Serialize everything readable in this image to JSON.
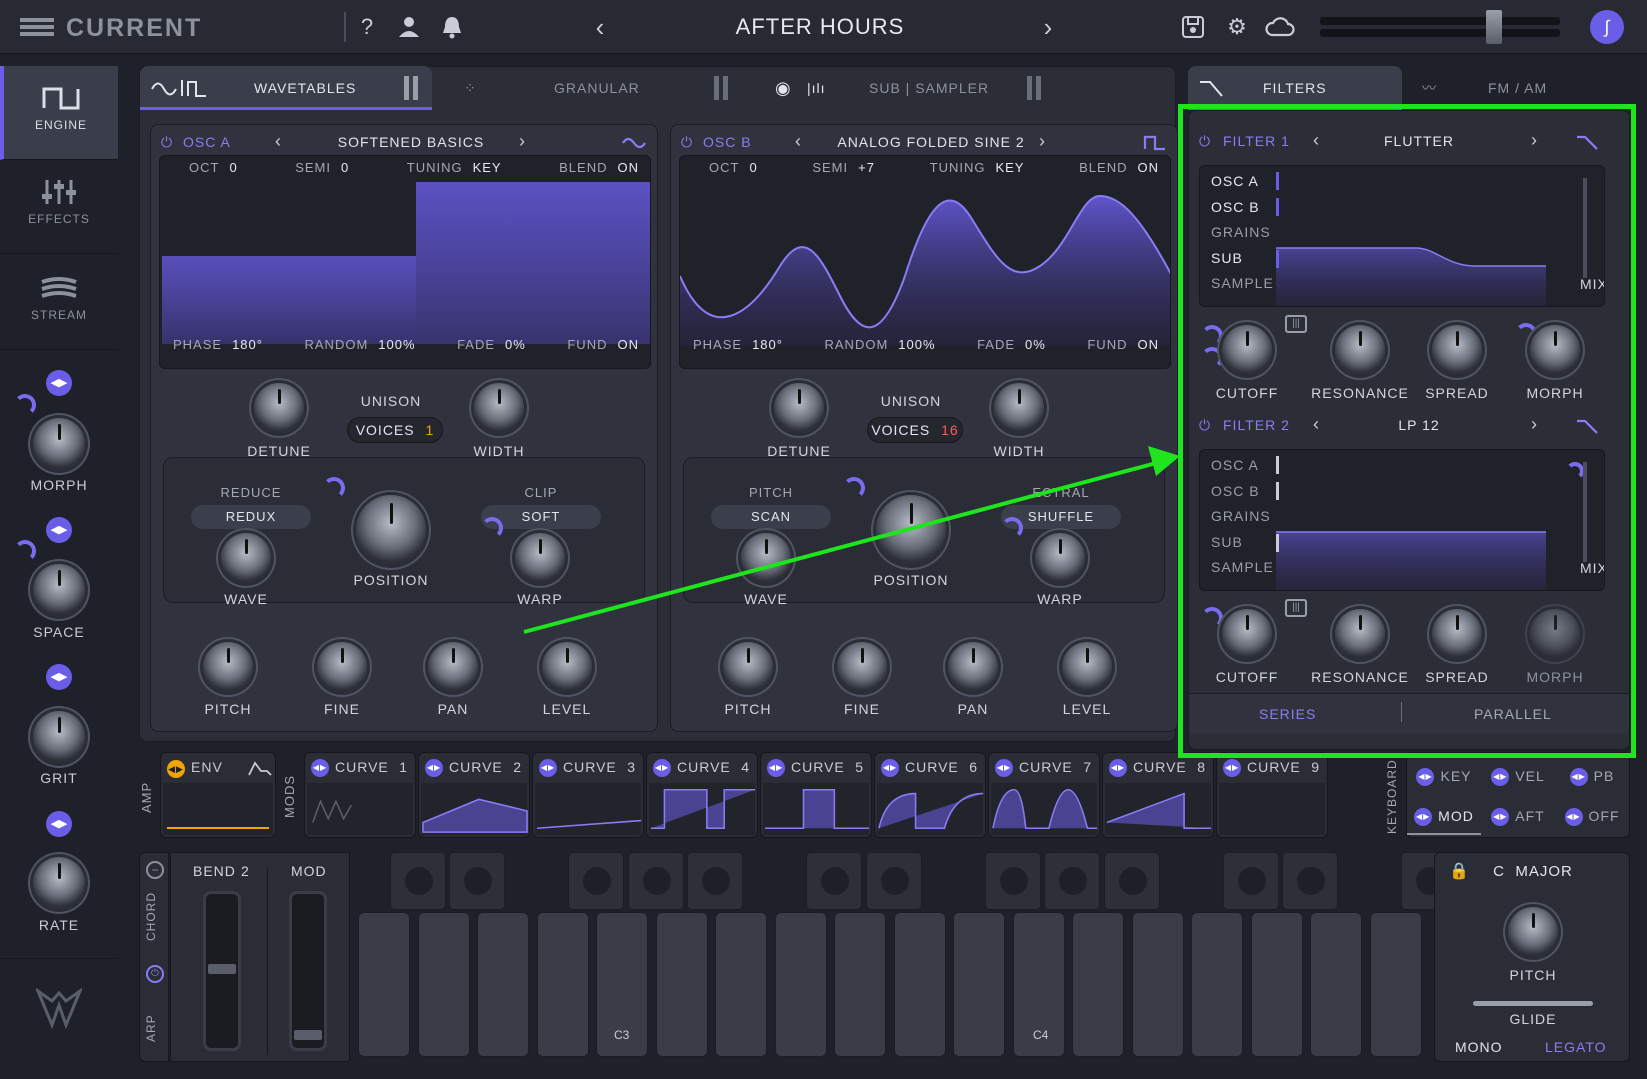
{
  "app": {
    "logo_text": "CURRENT",
    "preset_name": "AFTER HOURS",
    "avatar_glyph": "∫"
  },
  "sidebar": {
    "tabs": [
      {
        "label": "ENGINE",
        "icon": "square-wave-icon"
      },
      {
        "label": "EFFECTS",
        "icon": "sliders-icon"
      },
      {
        "label": "STREAM",
        "icon": "stream-icon"
      }
    ],
    "macros": [
      {
        "label": "MORPH"
      },
      {
        "label": "SPACE"
      },
      {
        "label": "GRIT"
      },
      {
        "label": "RATE"
      }
    ]
  },
  "engine_tabs": {
    "wavetables": "WAVETABLES",
    "granular": "GRANULAR",
    "sub_sampler": "SUB | SAMPLER",
    "filters": "FILTERS",
    "fm_am": "FM / AM"
  },
  "osc_a": {
    "title": "OSC A",
    "preset": "SOFTENED BASICS",
    "oct_label": "OCT",
    "oct": "0",
    "semi_label": "SEMI",
    "semi": "0",
    "tuning_label": "TUNING",
    "tuning": "KEY",
    "blend_label": "BLEND",
    "blend": "ON",
    "phase_label": "PHASE",
    "phase": "180°",
    "random_label": "RANDOM",
    "random": "100%",
    "fade_label": "FADE",
    "fade": "0%",
    "fund_label": "FUND",
    "fund": "ON",
    "unison": "UNISON",
    "voices_label": "VOICES",
    "voices": "1",
    "detune": "DETUNE",
    "width": "WIDTH",
    "left_mod_label": "REDUCE",
    "left_mod_value": "REDUX",
    "right_mod_label": "CLIP",
    "right_mod_value": "SOFT",
    "wave": "WAVE",
    "position": "POSITION",
    "warp": "WARP",
    "pitch": "PITCH",
    "fine": "FINE",
    "pan": "PAN",
    "level": "LEVEL"
  },
  "osc_b": {
    "title": "OSC B",
    "preset": "ANALOG FOLDED SINE 2",
    "oct_label": "OCT",
    "oct": "0",
    "semi_label": "SEMI",
    "semi": "+7",
    "tuning_label": "TUNING",
    "tuning": "KEY",
    "blend_label": "BLEND",
    "blend": "ON",
    "phase_label": "PHASE",
    "phase": "180°",
    "random_label": "RANDOM",
    "random": "100%",
    "fade_label": "FADE",
    "fade": "0%",
    "fund_label": "FUND",
    "fund": "ON",
    "unison": "UNISON",
    "voices_label": "VOICES",
    "voices": "16",
    "detune": "DETUNE",
    "width": "WIDTH",
    "left_mod_label": "PITCH",
    "left_mod_value": "SCAN",
    "right_mod_label": "ECTRAL",
    "right_mod_value": "SHUFFLE",
    "wave": "WAVE",
    "position": "POSITION",
    "warp": "WARP",
    "pitch": "PITCH",
    "fine": "FINE",
    "pan": "PAN",
    "level": "LEVEL"
  },
  "filter_1": {
    "title": "FILTER 1",
    "type": "FLUTTER",
    "sources": [
      "OSC A",
      "OSC B",
      "GRAINS",
      "SUB",
      "SAMPLE"
    ],
    "mix": "MIX",
    "cutoff": "CUTOFF",
    "resonance": "RESONANCE",
    "spread": "SPREAD",
    "morph": "MORPH"
  },
  "filter_2": {
    "title": "FILTER 2",
    "type": "LP 12",
    "sources": [
      "OSC A",
      "OSC B",
      "GRAINS",
      "SUB",
      "SAMPLE"
    ],
    "mix": "MIX",
    "cutoff": "CUTOFF",
    "resonance": "RESONANCE",
    "spread": "SPREAD",
    "morph": "MORPH"
  },
  "routing": {
    "series": "SERIES",
    "parallel": "PARALLEL"
  },
  "mods": {
    "amp_label": "AMP",
    "mods_label": "MODS",
    "env": "ENV",
    "curves": [
      {
        "label": "CURVE",
        "num": "1"
      },
      {
        "label": "CURVE",
        "num": "2"
      },
      {
        "label": "CURVE",
        "num": "3"
      },
      {
        "label": "CURVE",
        "num": "4"
      },
      {
        "label": "CURVE",
        "num": "5"
      },
      {
        "label": "CURVE",
        "num": "6"
      },
      {
        "label": "CURVE",
        "num": "7"
      },
      {
        "label": "CURVE",
        "num": "8"
      },
      {
        "label": "CURVE",
        "num": "9"
      }
    ],
    "keyboard_label": "KEYBOARD",
    "kb_sources": [
      "KEY",
      "VEL",
      "PB",
      "MOD",
      "AFT",
      "OFF"
    ]
  },
  "perform": {
    "chord": "CHORD",
    "arp": "ARP",
    "bend_label": "BEND",
    "bend": "2",
    "mod": "MOD",
    "key_c3": "C3",
    "key_c4": "C4",
    "scale": "C  MAJOR",
    "pitch": "PITCH",
    "glide": "GLIDE",
    "mono": "MONO",
    "legato": "LEGATO"
  },
  "colors": {
    "accent": "#6a5de8",
    "highlight": "#1ee51e",
    "voices_value": "#f2a400"
  }
}
